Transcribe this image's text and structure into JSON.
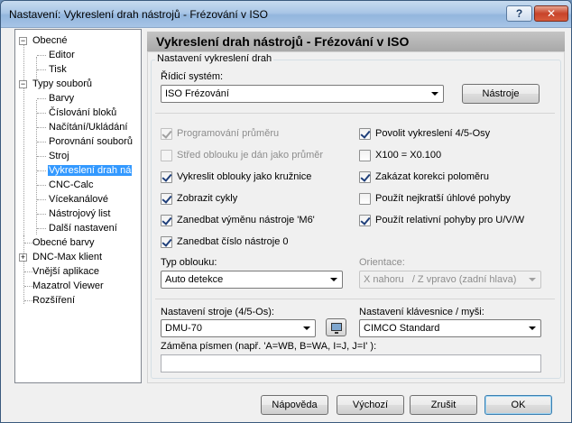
{
  "window": {
    "title": "Nastavení: Vykreslení drah nástrojů - Frézování v ISO",
    "help_label": "?",
    "close_label": "✕"
  },
  "tree": {
    "items": [
      {
        "label": "Obecné",
        "expander": "−"
      },
      {
        "label": "Editor"
      },
      {
        "label": "Tisk"
      },
      {
        "label": "Typy souborů",
        "expander": "−"
      },
      {
        "label": "Barvy"
      },
      {
        "label": "Číslování bloků"
      },
      {
        "label": "Načítání/Ukládání"
      },
      {
        "label": "Porovnání souborů"
      },
      {
        "label": "Stroj"
      },
      {
        "label": "Vykreslení drah ná",
        "selected": true
      },
      {
        "label": "CNC-Calc"
      },
      {
        "label": "Vícekanálové"
      },
      {
        "label": "Nástrojový list"
      },
      {
        "label": "Další nastavení"
      },
      {
        "label": "Obecné barvy"
      },
      {
        "label": "DNC-Max klient",
        "expander": "+"
      },
      {
        "label": "Vnější aplikace"
      },
      {
        "label": "Mazatrol Viewer"
      },
      {
        "label": "Rozšíření"
      }
    ]
  },
  "panel": {
    "title": "Vykreslení drah nástrojů - Frézování v ISO",
    "group_title": "Nastavení vykreslení drah",
    "control_system_label": "Řídicí systém:",
    "control_system_value": "ISO Frézování",
    "tools_button": "Nástroje",
    "checkboxes_left": [
      {
        "label": "Programování průměru",
        "checked": true,
        "disabled": true
      },
      {
        "label": "Střed oblouku je dán jako průměr",
        "checked": false,
        "disabled": true
      },
      {
        "label": "Vykreslit oblouky jako kružnice",
        "checked": true,
        "disabled": false
      },
      {
        "label": "Zobrazit cykly",
        "checked": true,
        "disabled": false
      },
      {
        "label": "Zanedbat výměnu nástroje 'M6'",
        "checked": true,
        "disabled": false
      },
      {
        "label": "Zanedbat číslo nástroje 0",
        "checked": true,
        "disabled": false
      }
    ],
    "checkboxes_right": [
      {
        "label": "Povolit vykreslení 4/5-Osy",
        "checked": true,
        "disabled": false
      },
      {
        "label": "X100 = X0.100",
        "checked": false,
        "disabled": false
      },
      {
        "label": "Zakázat korekci poloměru",
        "checked": true,
        "disabled": false
      },
      {
        "label": "Použít nejkratší úhlové pohyby",
        "checked": false,
        "disabled": false
      },
      {
        "label": "Použít relativní pohyby pro U/V/W",
        "checked": true,
        "disabled": false
      }
    ],
    "arc_type_label": "Typ oblouku:",
    "arc_type_value": "Auto detekce",
    "orientation_label": "Orientace:",
    "orientation_value": "X nahoru   / Z vpravo (zadní hlava)",
    "machine_label": "Nastavení stroje (4/5-Os):",
    "machine_value": "DMU-70",
    "machine_icon": "monitor-icon",
    "keyboard_label": "Nastavení klávesnice / myši:",
    "keyboard_value": "CIMCO Standard",
    "letter_swap_label": "Záměna písmen (např. 'A=WB, B=WA, I=J, J=I' ):",
    "letter_swap_value": ""
  },
  "footer": {
    "help_button": "Nápověda",
    "default_button": "Výchozí",
    "cancel_button": "Zrušit",
    "ok_button": "OK"
  }
}
